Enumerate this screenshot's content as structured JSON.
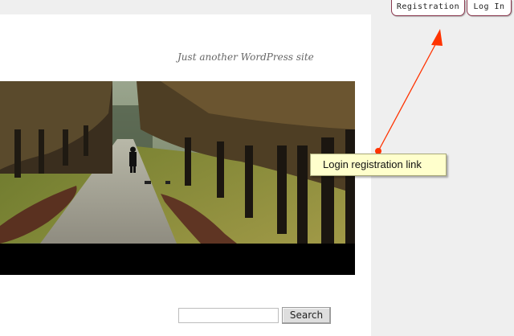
{
  "site": {
    "tagline": "Just another WordPress site"
  },
  "header_image": {
    "description_icon": "landscape-photo"
  },
  "top_links": {
    "registration": "Registration",
    "login": "Log In"
  },
  "annotation": {
    "label": "Login registration link",
    "arrow_color": "#ff3300"
  },
  "search": {
    "input_value": "",
    "button_label": "Search"
  },
  "colors": {
    "page_bg": "#efefef",
    "content_bg": "#ffffff",
    "button_border": "#8b3a50",
    "callout_bg": "#ffffcc"
  }
}
